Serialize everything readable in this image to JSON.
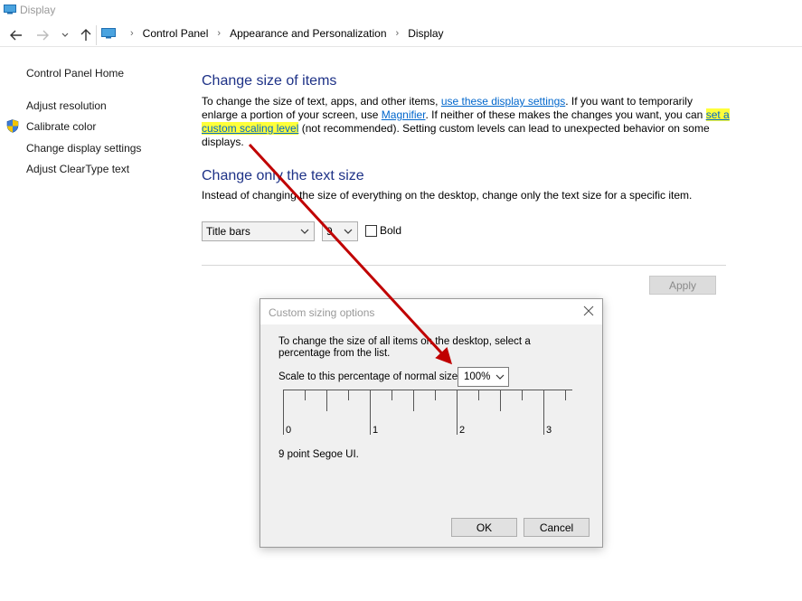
{
  "window": {
    "title": "Display"
  },
  "address": {
    "crumbs": [
      "Control Panel",
      "Appearance and Personalization",
      "Display"
    ]
  },
  "sidebar": {
    "items": [
      {
        "label": "Control Panel Home"
      },
      {
        "label": "Adjust resolution"
      },
      {
        "label": "Calibrate color"
      },
      {
        "label": "Change display settings"
      },
      {
        "label": "Adjust ClearType text"
      }
    ]
  },
  "main": {
    "section1": {
      "heading": "Change size of items",
      "p1": "To change the size of text, apps, and other items, ",
      "link1": "use these display settings",
      "p2": ".  If you want to temporarily enlarge a portion of your screen, use ",
      "link2": "Magnifier",
      "p3": ".  If neither of these makes the changes you want, you can ",
      "link3": "set a custom scaling level",
      "p4": " (not recommended).  Setting custom levels can lead to unexpected behavior on some displays."
    },
    "section2": {
      "heading": "Change only the text size",
      "desc": "Instead of changing the size of everything on the desktop, change only the text size for a specific item."
    },
    "item_select": "Title bars",
    "size_select": "9",
    "bold_label": "Bold",
    "bold_checked": false,
    "apply_label": "Apply"
  },
  "dialog": {
    "title": "Custom sizing options",
    "desc": "To change the size of all items on the desktop, select a percentage from the list.",
    "scale_label": "Scale to this percentage of normal size:",
    "scale_value": "100%",
    "ruler_labels": [
      "0",
      "1",
      "2",
      "3"
    ],
    "font_sample": "9 point Segoe UI.",
    "ok_label": "OK",
    "cancel_label": "Cancel"
  },
  "colors": {
    "heading": "#1e3287",
    "link": "#0066cc",
    "highlight": "#ffff3a",
    "annotation_arrow": "#c00000"
  }
}
